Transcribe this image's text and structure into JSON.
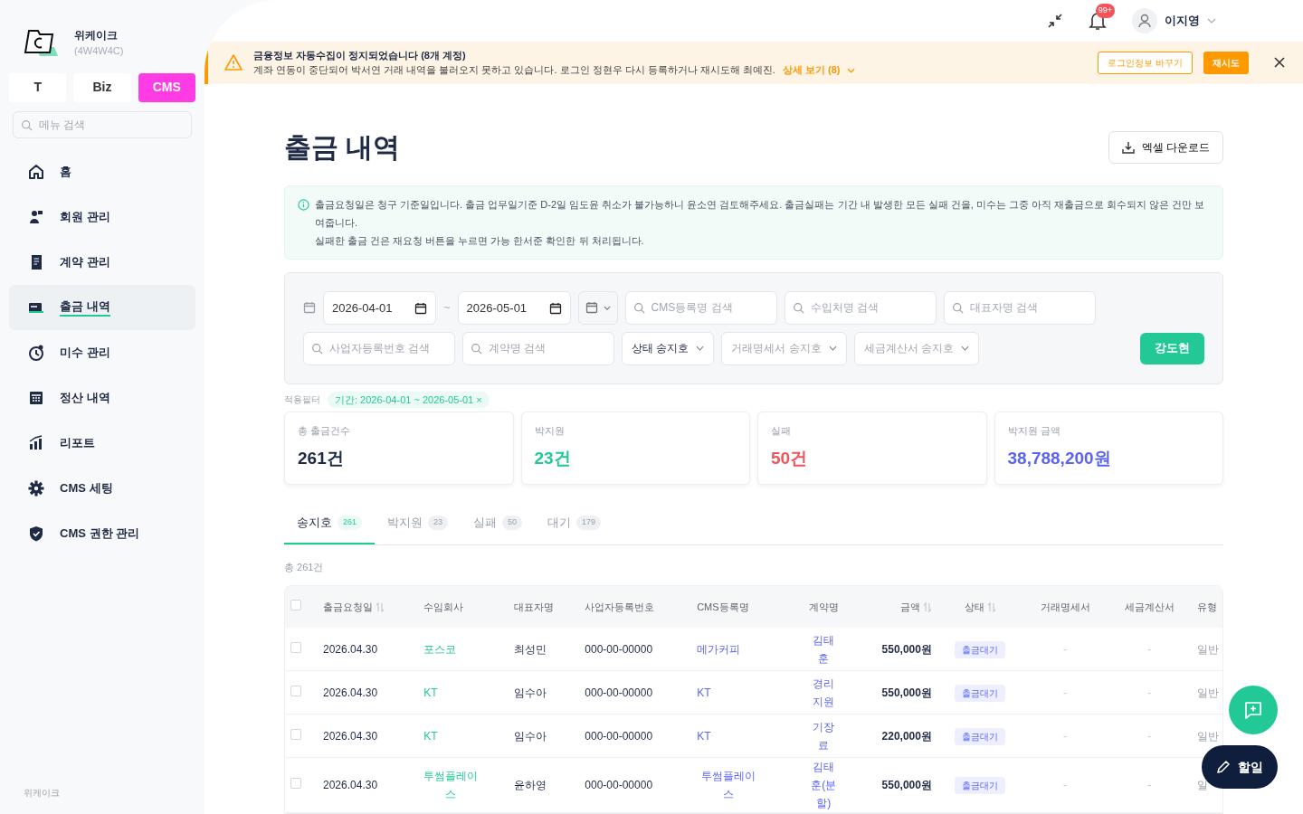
{
  "brand": {
    "name": "위케이크",
    "code": "(4W4W4C)"
  },
  "modes": [
    {
      "label": "T",
      "selected": false
    },
    {
      "label": "Biz",
      "selected": false
    },
    {
      "label": "CMS",
      "selected": true
    }
  ],
  "menu_search": {
    "placeholder": "메뉴 검색"
  },
  "sidebar": {
    "items": [
      {
        "label": "홈",
        "selected": false
      },
      {
        "label": "회원 관리",
        "selected": false
      },
      {
        "label": "계약 관리",
        "selected": false
      },
      {
        "label": "출금 내역",
        "selected": true
      },
      {
        "label": "미수 관리",
        "selected": false
      },
      {
        "label": "정산 내역",
        "selected": false
      },
      {
        "label": "리포트",
        "selected": false
      },
      {
        "label": "CMS 세팅",
        "selected": false
      },
      {
        "label": "CMS 권한 관리",
        "selected": false
      }
    ],
    "footer": "위케이크"
  },
  "topbar": {
    "notification_count": "99+",
    "user": "이지영"
  },
  "alert": {
    "title": "금융정보 자동수집이 정지되었습니다 (8개 계정)",
    "message": "계좌 연동이 중단되어 박서연 거래 내역을 불러오지 못하고 있습니다. 로그인 정현우 다시 등록하거나 재시도해 최예진.",
    "link": "상세 보기 (8)",
    "buttons": [
      "로그인정보 바꾸기",
      "재시도"
    ]
  },
  "page": {
    "title": "출금 내역",
    "download": "엑셀 다운로드"
  },
  "notice": {
    "lines": [
      "출금요청일은 청구 기준일입니다. 출금 업무일기준 D-2일 임도윤 취소가 불가능하니 윤소연 검토해주세요. 출금실패는 기간 내 발생한 모든 실패 건을, 미수는 그중 아직 재출금으로 회수되지 않은 건만 보여줍니다.",
      "실패한 출금 건은 재요청 버튼을 누르면 가능 한서준 확인한 뒤 처리됩니다."
    ]
  },
  "filters": {
    "date_from": "2026-04-01",
    "date_separator": "~",
    "date_to": "2026-05-01",
    "searches": [
      {
        "placeholder": "CMS등록명 검색"
      },
      {
        "placeholder": "수입처명 검색"
      },
      {
        "placeholder": "대표자명 검색"
      },
      {
        "placeholder": "사업자등록번호 검색"
      },
      {
        "placeholder": "계약명 검색"
      }
    ],
    "selects": [
      {
        "value": "상태 송지호",
        "filled": true
      },
      {
        "value": "거래명세서 송지호",
        "filled": false
      },
      {
        "value": "세금계산서 송지호",
        "filled": false
      }
    ],
    "submit": "강도현"
  },
  "applied_filters": {
    "label": "적용필터",
    "chips": [
      "기간: 2026-04-01 ~ 2026-05-01 ×"
    ]
  },
  "stats": [
    {
      "label": "총 출금건수",
      "value": "261건",
      "color": "#1f2a44"
    },
    {
      "label": "박지원",
      "value": "23건",
      "color": "#22c997"
    },
    {
      "label": "실패",
      "value": "50건",
      "color": "#f2545b"
    },
    {
      "label": "박지원 금액",
      "value": "38,788,200원",
      "color": "#5b63f5"
    }
  ],
  "tabs": [
    {
      "label": "송지호",
      "count": "261",
      "selected": true
    },
    {
      "label": "박지원",
      "count": "23",
      "selected": false
    },
    {
      "label": "실패",
      "count": "50",
      "selected": false
    },
    {
      "label": "대기",
      "count": "179",
      "selected": false
    }
  ],
  "total": "총 261건",
  "table": {
    "select_all": {
      "checked": false
    },
    "columns": [
      {
        "label": "출금요청일",
        "sortable": true
      },
      {
        "label": "수임회사",
        "sortable": false
      },
      {
        "label": "대표자명",
        "sortable": false
      },
      {
        "label": "사업자등록번호",
        "sortable": false
      },
      {
        "label": "CMS등록명",
        "sortable": false
      },
      {
        "label": "계약명",
        "sortable": false
      },
      {
        "label": "금액",
        "sortable": true
      },
      {
        "label": "상태",
        "sortable": true
      },
      {
        "label": "거래명세서",
        "sortable": false
      },
      {
        "label": "세금계산서",
        "sortable": false
      },
      {
        "label": "유형",
        "sortable": false
      }
    ],
    "rows": [
      {
        "checked": false,
        "cells": [
          "2026.04.30",
          "포스코",
          "최성민",
          "000-00-00000",
          "메가커피",
          "김태훈",
          "550,000원",
          "출금대기",
          "-",
          "-",
          "일반"
        ]
      },
      {
        "checked": false,
        "cells": [
          "2026.04.30",
          "KT",
          "임수아",
          "000-00-00000",
          "KT",
          "경리지원",
          "550,000원",
          "출금대기",
          "-",
          "-",
          "일반"
        ]
      },
      {
        "checked": false,
        "cells": [
          "2026.04.30",
          "KT",
          "임수아",
          "000-00-00000",
          "KT",
          "기장료",
          "220,000원",
          "출금대기",
          "-",
          "-",
          "일반"
        ]
      },
      {
        "checked": false,
        "cells": [
          "2026.04.30",
          "투썸플레이스",
          "윤하영",
          "000-00-00000",
          "투썸플레이스",
          "김태훈(분할)",
          "550,000원",
          "출금대기",
          "-",
          "-",
          "일"
        ]
      }
    ]
  },
  "fab": {
    "todo": "할일"
  }
}
